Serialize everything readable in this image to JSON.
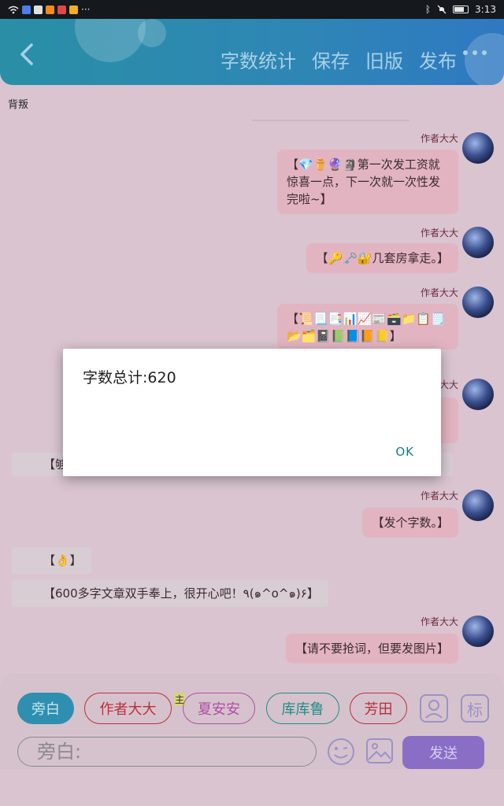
{
  "status_bar": {
    "time": "3:13",
    "dots": "···"
  },
  "header": {
    "actions": [
      "字数统计",
      "保存",
      "旧版",
      "发布"
    ]
  },
  "background_label": "背叛",
  "messages": [
    {
      "side": "right",
      "author": "作者大大",
      "text": "【💎⚱️🔮🗿第一次发工资就惊喜一点，下一次就一次性发完啦~】"
    },
    {
      "side": "right",
      "author": "作者大大",
      "text": "【🔑🗝️🔐几套房拿走。】"
    },
    {
      "side": "right",
      "author": "作者大大",
      "text": "【📜📃📑📊📈📰🗃️📁📋🗒️📂🗂️📓📗📘📙📒】"
    },
    {
      "side": "right",
      "author": "作者大大",
      "text": ""
    },
    {
      "side": "left",
      "author": "",
      "text": "【够"
    },
    {
      "side": "right",
      "author": "作者大大",
      "text": "【发个字数。】"
    },
    {
      "side": "left",
      "author": "",
      "text": "【👌】"
    },
    {
      "side": "left",
      "author": "",
      "text": "【600多字文章双手奉上，很开心吧！٩(๑^o^๑)۶】"
    },
    {
      "side": "right",
      "author": "作者大大",
      "text": "【请不要抢词，但要发图片】"
    }
  ],
  "bottom": {
    "roles": [
      {
        "label": "旁白",
        "active": true,
        "color": "#2e8fb0"
      },
      {
        "label": "作者大大",
        "active": false,
        "color": "#b9303a"
      },
      {
        "label": "夏安安",
        "active": false,
        "color": "#b04ea3"
      },
      {
        "label": "库库鲁",
        "active": false,
        "color": "#1f8e86"
      },
      {
        "label": "芳田",
        "active": false,
        "color": "#b9303a"
      }
    ],
    "badge": "主",
    "tag_label": "标",
    "input_placeholder": "旁白:",
    "send_label": "发送"
  },
  "dialog": {
    "message": "字数总计:620",
    "ok_label": "OK"
  }
}
